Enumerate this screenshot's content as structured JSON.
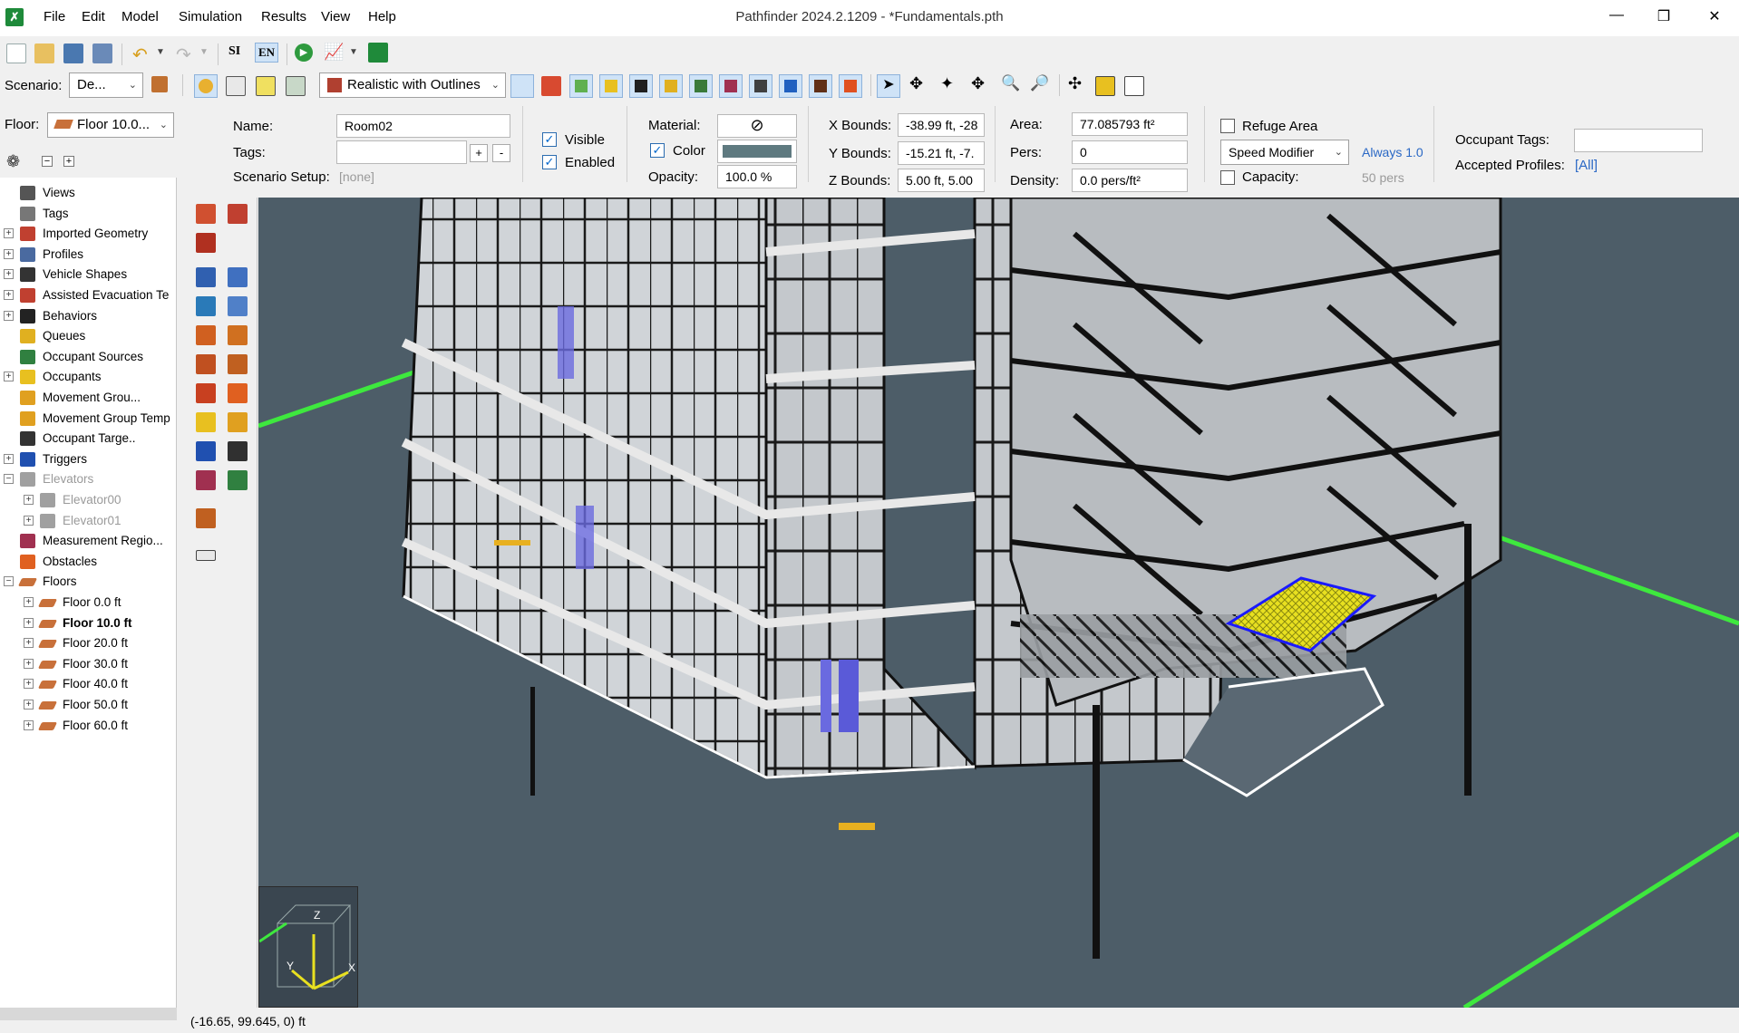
{
  "window": {
    "title": "Pathfinder 2024.2.1209 - *Fundamentals.pth",
    "app_icon": "pathfinder-icon",
    "minimize": "—",
    "maximize": "❒",
    "close": "✕"
  },
  "menu": [
    "File",
    "Edit",
    "Model",
    "Simulation",
    "Results",
    "View",
    "Help"
  ],
  "toolbar": {
    "units_si": "SI",
    "units_en": "EN",
    "scenario_label": "Scenario:",
    "scenario_value": "De...",
    "render_mode": "Realistic with Outlines",
    "floor_label": "Floor:",
    "floor_value": "Floor 10.0..."
  },
  "properties": {
    "name_label": "Name:",
    "name_value": "Room02",
    "tags_label": "Tags:",
    "tags_value": "",
    "add_tag": "+",
    "remove_tag": "-",
    "scenario_setup_label": "Scenario Setup:",
    "scenario_setup_value": "[none]",
    "visible_label": "Visible",
    "enabled_label": "Enabled",
    "material_label": "Material:",
    "color_label": "Color",
    "color_value": "#5f7a80",
    "opacity_label": "Opacity:",
    "opacity_value": "100.0 %",
    "xbounds_label": "X Bounds:",
    "xbounds_value": "-38.99 ft, -28",
    "ybounds_label": "Y Bounds:",
    "ybounds_value": "-15.21 ft, -7.",
    "zbounds_label": "Z Bounds:",
    "zbounds_value": "5.00 ft, 5.00",
    "area_label": "Area:",
    "area_value": "77.085793 ft²",
    "pers_label": "Pers:",
    "pers_value": "0",
    "density_label": "Density:",
    "density_value": "0.0 pers/ft²",
    "refuge_label": "Refuge Area",
    "speed_modifier": "Speed Modifier",
    "speed_value": "Always 1.0",
    "capacity_label": "Capacity:",
    "capacity_value": "50 pers",
    "occ_tags_label": "Occupant Tags:",
    "accepted_profiles_label": "Accepted Profiles:",
    "accepted_profiles_value": "[All]"
  },
  "tree": {
    "items": [
      {
        "label": "Views",
        "icon": "camera-icon",
        "indent": 0,
        "exp": ""
      },
      {
        "label": "Tags",
        "icon": "tag-icon",
        "indent": 0,
        "exp": ""
      },
      {
        "label": "Imported Geometry",
        "icon": "geometry-icon",
        "indent": 0,
        "exp": "+"
      },
      {
        "label": "Profiles",
        "icon": "profile-icon",
        "indent": 0,
        "exp": "+"
      },
      {
        "label": "Vehicle Shapes",
        "icon": "wheelchair-icon",
        "indent": 0,
        "exp": "+"
      },
      {
        "label": "Assisted Evacuation Te",
        "icon": "assisted-icon",
        "indent": 0,
        "exp": "+"
      },
      {
        "label": "Behaviors",
        "icon": "footprints-icon",
        "indent": 0,
        "exp": "+"
      },
      {
        "label": "Queues",
        "icon": "queue-icon",
        "indent": 0,
        "exp": ""
      },
      {
        "label": "Occupant Sources",
        "icon": "source-icon",
        "indent": 0,
        "exp": ""
      },
      {
        "label": "Occupants",
        "icon": "occupants-icon",
        "indent": 0,
        "exp": "+"
      },
      {
        "label": "Movement Grou...",
        "icon": "group-icon",
        "indent": 0,
        "exp": ""
      },
      {
        "label": "Movement Group Temp",
        "icon": "group-template-icon",
        "indent": 0,
        "exp": ""
      },
      {
        "label": "Occupant Targe..",
        "icon": "target-icon",
        "indent": 0,
        "exp": ""
      },
      {
        "label": "Triggers",
        "icon": "trigger-icon",
        "indent": 0,
        "exp": "+"
      },
      {
        "label": "Elevators",
        "icon": "elevator-icon",
        "indent": 0,
        "exp": "−",
        "grey": true
      },
      {
        "label": "Elevator00",
        "icon": "elevator-icon",
        "indent": 1,
        "exp": "+",
        "grey": true
      },
      {
        "label": "Elevator01",
        "icon": "elevator-icon",
        "indent": 1,
        "exp": "+",
        "grey": true
      },
      {
        "label": "Measurement Regio...",
        "icon": "measure-region-icon",
        "indent": 0,
        "exp": ""
      },
      {
        "label": "Obstacles",
        "icon": "obstacle-icon",
        "indent": 0,
        "exp": ""
      },
      {
        "label": "Floors",
        "icon": "floor-icon",
        "indent": 0,
        "exp": "−"
      },
      {
        "label": "Floor 0.0 ft",
        "icon": "floor-icon",
        "indent": 1,
        "exp": "+"
      },
      {
        "label": "Floor 10.0 ft",
        "icon": "floor-icon",
        "indent": 1,
        "exp": "+",
        "bold": true
      },
      {
        "label": "Floor 20.0 ft",
        "icon": "floor-icon",
        "indent": 1,
        "exp": "+"
      },
      {
        "label": "Floor 30.0 ft",
        "icon": "floor-icon",
        "indent": 1,
        "exp": "+"
      },
      {
        "label": "Floor 40.0 ft",
        "icon": "floor-icon",
        "indent": 1,
        "exp": "+"
      },
      {
        "label": "Floor 50.0 ft",
        "icon": "floor-icon",
        "indent": 1,
        "exp": "+"
      },
      {
        "label": "Floor 60.0 ft",
        "icon": "floor-icon",
        "indent": 1,
        "exp": "+"
      }
    ]
  },
  "axis_gizmo": {
    "z": "Z",
    "y": "Y",
    "x": "X"
  },
  "status": {
    "coords": "(-16.65, 99.645, 0) ft"
  }
}
